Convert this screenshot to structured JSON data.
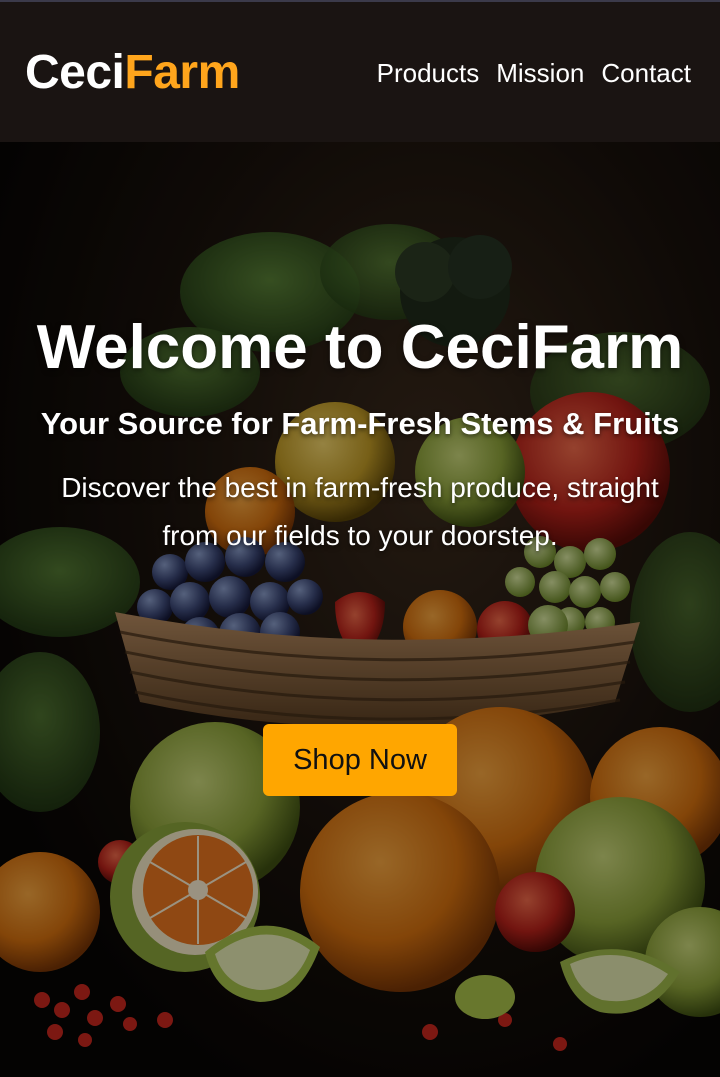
{
  "brand": {
    "part1": "Ceci",
    "part2": "Farm",
    "color_primary": "#ffffff",
    "color_accent": "#ffa51c"
  },
  "nav": {
    "items": [
      {
        "label": "Products"
      },
      {
        "label": "Mission"
      },
      {
        "label": "Contact"
      }
    ]
  },
  "hero": {
    "title": "Welcome to CeciFarm",
    "subtitle": "Your Source for Farm-Fresh Stems & Fruits",
    "description": "Discover the best in farm-fresh produce, straight from our fields to your doorstep.",
    "cta_label": "Shop Now",
    "cta_color": "#ffa600",
    "background_image": "fruit-basket-photo"
  },
  "colors": {
    "header_bg": "#1a1412"
  }
}
